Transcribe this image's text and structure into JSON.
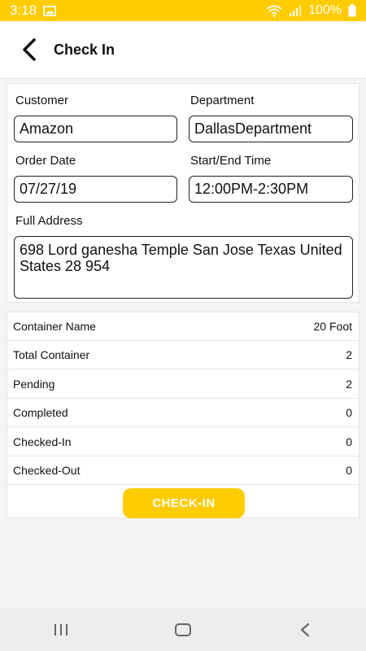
{
  "status_bar": {
    "time": "3:18",
    "battery": "100%",
    "icons": [
      "image-icon",
      "wifi-icon",
      "signal-icon",
      "battery-icon"
    ]
  },
  "header": {
    "title": "Check In",
    "back_icon": "back-arrow-icon"
  },
  "form": {
    "customer_label": "Customer",
    "customer_value": "Amazon",
    "department_label": "Department",
    "department_value": "DallasDepartment",
    "order_date_label": "Order Date",
    "order_date_value": "07/27/19",
    "time_label": "Start/End Time",
    "time_value": "12:00PM-2:30PM",
    "address_label": "Full Address",
    "address_value": "698 Lord ganesha Temple  San Jose Texas United States 28 954"
  },
  "summary": {
    "rows": [
      {
        "label": "Container Name",
        "value": "20 Foot"
      },
      {
        "label": "Total Container",
        "value": "2"
      },
      {
        "label": "Pending",
        "value": "2"
      },
      {
        "label": "Completed",
        "value": "0"
      },
      {
        "label": "Checked-In",
        "value": "0"
      },
      {
        "label": "Checked-Out",
        "value": "0"
      }
    ],
    "button_label": "CHECK-IN"
  },
  "nav": {
    "icons": [
      "recent-apps-icon",
      "home-icon",
      "nav-back-icon"
    ]
  },
  "colors": {
    "accent": "#ffcc00",
    "background": "#f4f4f4"
  }
}
